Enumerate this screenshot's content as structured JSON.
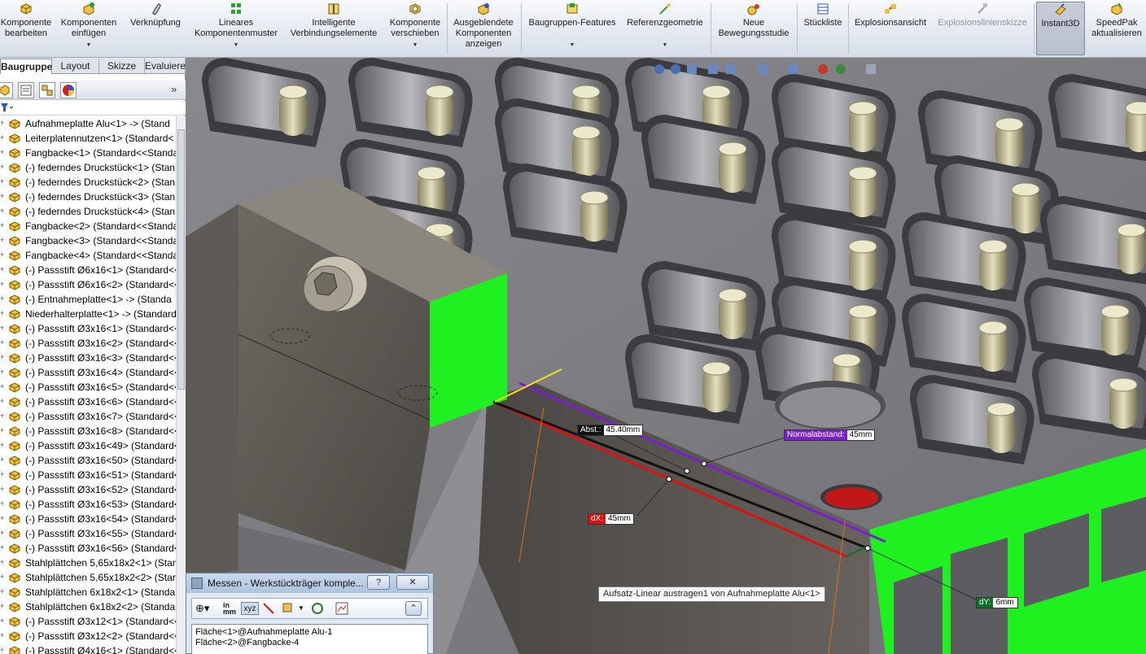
{
  "ribbon": {
    "items": [
      {
        "label": "Komponente\nbearbeiten",
        "icon": "edit-component-icon"
      },
      {
        "label": "Komponenten\neinfügen",
        "icon": "insert-components-icon"
      },
      {
        "label": "Verknüpfung",
        "icon": "mate-paperclip-icon"
      },
      {
        "label": "Lineares\nKomponentenmuster",
        "icon": "linear-pattern-icon"
      },
      {
        "label": "Intelligente\nVerbindungselemente",
        "icon": "smart-fasteners-icon"
      },
      {
        "label": "Komponente\nverschieben",
        "icon": "move-component-icon"
      },
      {
        "label": "Ausgeblendete\nKomponenten\nanzeigen",
        "icon": "show-hidden-icon"
      },
      {
        "label": "Baugruppen-Features",
        "icon": "assembly-features-icon"
      },
      {
        "label": "Referenzgeometrie",
        "icon": "reference-geometry-icon"
      },
      {
        "label": "Neue\nBewegungsstudie",
        "icon": "motion-study-icon"
      },
      {
        "label": "Stückliste",
        "icon": "bom-icon"
      },
      {
        "label": "Explosionsansicht",
        "icon": "exploded-view-icon"
      },
      {
        "label": "Explosionslinienskizze",
        "icon": "explode-line-sketch-icon"
      },
      {
        "label": "Instant3D",
        "icon": "instant3d-icon"
      },
      {
        "label": "SpeedPak\naktualisieren",
        "icon": "speedpak-icon"
      }
    ]
  },
  "tabs": [
    "Baugruppe",
    "Layout",
    "Skizze",
    "Evaluieren"
  ],
  "tree": {
    "expand_more": "»",
    "items": [
      "Aufnahmeplatte Alu<1> -> (Stand",
      "Leiterplatennutzen<1> (Standard<",
      "Fangbacke<1> (Standard<<Standa",
      "(-) federndes Druckstück<1> (Stan",
      "(-) federndes Druckstück<2> (Stan",
      "(-) federndes Druckstück<3> (Stan",
      "(-) federndes Druckstück<4> (Stan",
      "Fangbacke<2> (Standard<<Standa",
      "Fangbacke<3> (Standard<<Standa",
      "Fangbacke<4> (Standard<<Standa",
      "(-) Passstift Ø6x16<1> (Standard<<",
      "(-) Passstift Ø6x16<2> (Standard<<",
      "(-) Entnahmeplatte<1> -> (Standa",
      "Niederhalterplatte<1> -> (Standard",
      "(-) Passstift Ø3x16<1> (Standard<<",
      "(-) Passstift Ø3x16<2> (Standard<<",
      "(-) Passstift Ø3x16<3> (Standard<<",
      "(-) Passstift Ø3x16<4> (Standard<<",
      "(-) Passstift Ø3x16<5> (Standard<<",
      "(-) Passstift Ø3x16<6> (Standard<<",
      "(-) Passstift Ø3x16<7> (Standard<<",
      "(-) Passstift Ø3x16<8> (Standard<<",
      "(-) Passstift Ø3x16<49> (Standard<",
      "(-) Passstift Ø3x16<50> (Standard<",
      "(-) Passstift Ø3x16<51> (Standard<",
      "(-) Passstift Ø3x16<52> (Standard<",
      "(-) Passstift Ø3x16<53> (Standard<",
      "(-) Passstift Ø3x16<54> (Standard<",
      "(-) Passstift Ø3x16<55> (Standard<",
      "(-) Passstift Ø3x16<56> (Standard<",
      "Stahlplättchen 5,65x18x2<1> (Stan",
      "Stahlplättchen 5,65x18x2<2> (Stan",
      "Stahlplättchen 6x18x2<1> (Standar",
      "Stahlplättchen 6x18x2<2> (Standar",
      "(-) Passstift Ø3x12<1> (Standard<<",
      "(-) Passstift Ø3x12<2> (Standard<<",
      "(-) Passstift Ø4x16<1> (Standard<<"
    ]
  },
  "viewport": {
    "labels": {
      "abst_key": "Abst.:",
      "abst_val": "45.40mm",
      "normal_key": "Normalabstand:",
      "normal_val": "45mm",
      "dx_key": "dX:",
      "dx_val": "45mm",
      "dy_key": "dY:",
      "dy_val": "6mm"
    },
    "tooltip": "Aufsatz-Linear austragen1 von Aufnahmeplatte Alu<1>",
    "colors": {
      "highlight": "#1ff01f",
      "dx": "#e01010",
      "normal": "#7a1fd0",
      "dy": "#0f6f2a",
      "abst": "#111111"
    }
  },
  "measure": {
    "title": "Messen - Werkstückträger komple...",
    "help": "?",
    "close": "✕",
    "units_label": "in\nmm",
    "collapse": "⌃",
    "results": [
      "Fläche<1>@Aufnahmeplatte Alu-1",
      "Fläche<2>@Fangbacke-4"
    ]
  }
}
